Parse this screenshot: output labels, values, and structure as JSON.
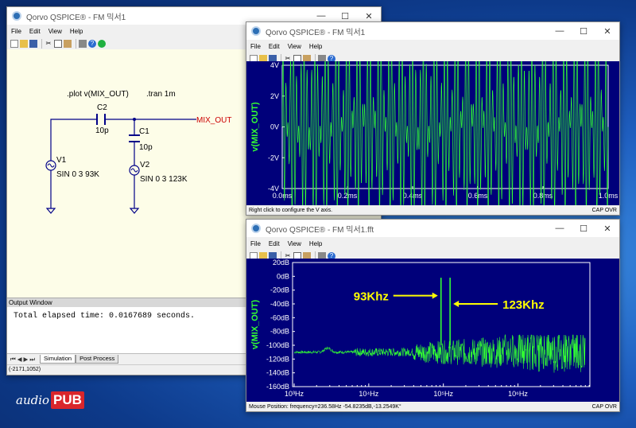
{
  "schematic_window": {
    "title": "Qorvo QSPICE® - FM 믹서1",
    "menu": [
      "File",
      "Edit",
      "View",
      "Help"
    ],
    "directives": [
      ".plot v(MIX_OUT)",
      ".tran 1m"
    ],
    "components": {
      "c2_name": "C2",
      "c2_value": "10p",
      "c1_name": "C1",
      "c1_value": "10p",
      "v1_name": "V1",
      "v1_value": "SIN 0 3 93K",
      "v2_name": "V2",
      "v2_value": "SIN 0 3 123K",
      "net_label": "MIX_OUT"
    },
    "output_window_title": "Output Window",
    "output_text": "Total elapsed time: 0.0167689 seconds.",
    "tabs": [
      "Simulation",
      "Post Process"
    ],
    "status": "(-2171,1052)"
  },
  "time_window": {
    "title": "Qorvo QSPICE® - FM 믹서1",
    "menu": [
      "File",
      "Edit",
      "View",
      "Help"
    ],
    "status_left": "Right click to configure the V axis.",
    "status_right": "CAP  OVR"
  },
  "fft_window": {
    "title": "Qorvo QSPICE® - FM 믹서1.fft",
    "menu": [
      "File",
      "Edit",
      "View",
      "Help"
    ],
    "status_left": "Mouse Position: frequency=236.58Hz  -54.8235dB,-13.2549K°",
    "status_right": "CAP  OVR",
    "annot_93": "93Khz",
    "annot_123": "123Khz"
  },
  "logo": {
    "audio": "audio",
    "pub": "PUB"
  },
  "chart_data": [
    {
      "type": "line",
      "ylabel": "v(MIX_OUT)",
      "x_ticks": [
        "0.0ms",
        "0.2ms",
        "0.4ms",
        "0.6ms",
        "0.8ms",
        "1.0ms"
      ],
      "y_ticks": [
        "4V",
        "2V",
        "0V",
        "-2V",
        "-4V"
      ],
      "xlim": [
        0,
        1.0
      ],
      "ylim": [
        -4,
        4
      ],
      "series": [
        {
          "formula": "3*sin(2π·93k·t)+3*sin(2π·123k·t)"
        }
      ]
    },
    {
      "type": "line",
      "ylabel": "v(MIX_OUT)",
      "x_ticks": [
        "10³Hz",
        "10⁴Hz",
        "10⁵Hz",
        "10⁶Hz"
      ],
      "y_ticks": [
        "20dB",
        "0dB",
        "-20dB",
        "-40dB",
        "-60dB",
        "-80dB",
        "-100dB",
        "-120dB",
        "-140dB",
        "-160dB"
      ],
      "xscale": "log",
      "ylim": [
        -160,
        20
      ],
      "peaks_hz": [
        93000,
        123000
      ]
    }
  ],
  "colors": {
    "plot_bg": "#00007a",
    "trace": "#33ff33",
    "annot": "#ffff00",
    "net": "#cc0000",
    "wire": "#000088"
  }
}
